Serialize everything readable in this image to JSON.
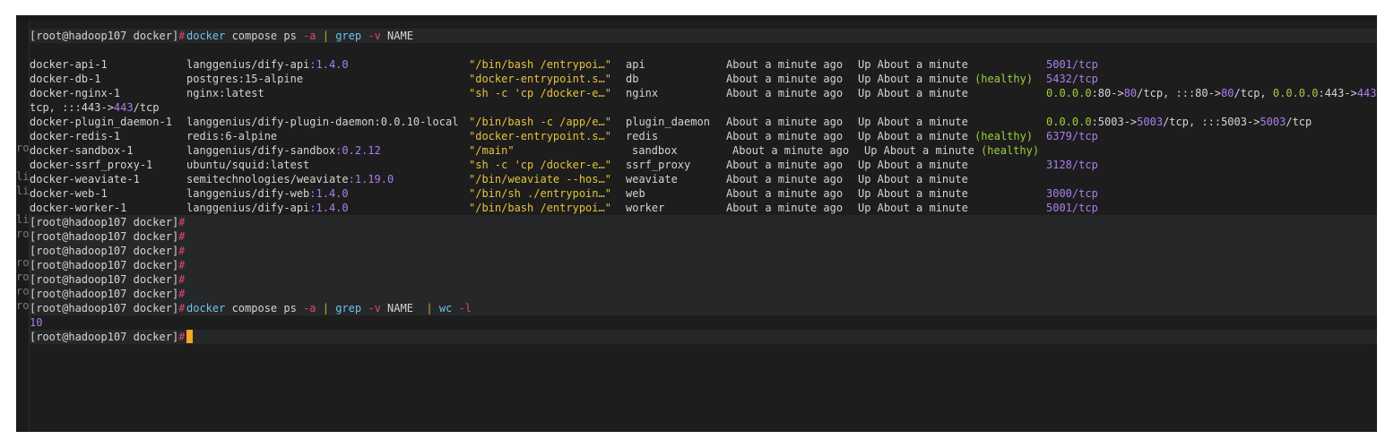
{
  "gutter": [
    "li",
    "ro",
    "li",
    "ro",
    "li",
    "ro",
    "ro",
    "ro",
    "ro",
    "ro"
  ],
  "prompt": "[root@hadoop107 docker]",
  "hash": "#",
  "command1": {
    "cmd1": "docker",
    "rest1": " compose ps ",
    "flag1": "-a",
    "pipe": " | ",
    "cmd2": "grep",
    "sp": " ",
    "flag2": "-v",
    "rest2": " NAME"
  },
  "containers": [
    {
      "name": "docker-api-1",
      "image": "langgenius/dify-api",
      "tag": ":1.4.0",
      "command": "\"/bin/bash /entrypoi…\"",
      "service": "api",
      "created": "About a minute ago",
      "status": "Up About a minute",
      "health": "",
      "ports": "5001/tcp"
    },
    {
      "name": "docker-db-1",
      "image": "postgres:15-alpine",
      "tag": "",
      "command": "\"docker-entrypoint.s…\"",
      "service": "db",
      "created": "About a minute ago",
      "status": "Up About a minute",
      "health": "(healthy)",
      "ports": "5432/tcp"
    },
    {
      "name": "docker-nginx-1",
      "image": "nginx:latest",
      "tag": "",
      "command": "\"sh -c 'cp /docker-e…\"",
      "service": "nginx",
      "created": "About a minute ago",
      "status": "Up About a minute",
      "health": "",
      "ports_parts": {
        "a": "0.0.0.0",
        "b": ":80->",
        "c": "80",
        "d": "/tcp, :::80->",
        "e": "80",
        "f": "/tcp, ",
        "g": "0.0.0.0",
        "h": ":443->",
        "i": "443/"
      },
      "ports_cont": {
        "a": "tcp, :::443->",
        "b": "443",
        "c": "/tcp"
      }
    },
    {
      "name": "docker-plugin_daemon-1",
      "image": "langgenius/dify-plugin-daemon:0.0.10-local",
      "tag": "",
      "command": "\"/bin/bash -c /app/e…\"",
      "service": "plugin_daemon",
      "created": "About a minute ago",
      "status": "Up About a minute",
      "health": "",
      "ports_parts": {
        "a": "0.0.0.0",
        "b": ":5003->",
        "c": "5003",
        "d": "/tcp, :::5003->",
        "e": "5003",
        "f": "/tcp"
      }
    },
    {
      "name": "docker-redis-1",
      "image": "redis:6-alpine",
      "tag": "",
      "command": "\"docker-entrypoint.s…\"",
      "service": "redis",
      "created": "About a minute ago",
      "status": "Up About a minute",
      "health": "(healthy)",
      "ports": "6379/tcp"
    },
    {
      "name": "docker-sandbox-1",
      "image": "langgenius/dify-sandbox",
      "tag": ":0.2.12",
      "command": "\"/main\"",
      "service": "sandbox",
      "created": "About a minute ago",
      "status": "Up About a minute",
      "health": "(healthy)",
      "ports": ""
    },
    {
      "name": "docker-ssrf_proxy-1",
      "image": "ubuntu/squid:latest",
      "tag": "",
      "command": "\"sh -c 'cp /docker-e…\"",
      "service": "ssrf_proxy",
      "created": "About a minute ago",
      "status": "Up About a minute",
      "health": "",
      "ports": "3128/tcp"
    },
    {
      "name": "docker-weaviate-1",
      "image": "semitechnologies/weaviate",
      "tag": ":1.19.0",
      "command": "\"/bin/weaviate --hos…\"",
      "service": "weaviate",
      "created": "About a minute ago",
      "status": "Up About a minute",
      "health": "",
      "ports": ""
    },
    {
      "name": "docker-web-1",
      "image": "langgenius/dify-web",
      "tag": ":1.4.0",
      "command": "\"/bin/sh ./entrypoin…\"",
      "service": "web",
      "created": "About a minute ago",
      "status": "Up About a minute",
      "health": "",
      "ports": "3000/tcp"
    },
    {
      "name": "docker-worker-1",
      "image": "langgenius/dify-api",
      "tag": ":1.4.0",
      "command": "\"/bin/bash /entrypoi…\"",
      "service": "worker",
      "created": "About a minute ago",
      "status": "Up About a minute",
      "health": "",
      "ports": "5001/tcp"
    }
  ],
  "command2": {
    "cmd1": "docker",
    "rest1": " compose ps ",
    "flag1": "-a",
    "pipe1": " | ",
    "cmd2": "grep",
    "sp": " ",
    "flag2": "-v",
    "rest2": " NAME  ",
    "pipe2": "| ",
    "cmd3": "wc",
    "sp2": " ",
    "flag3": "-l"
  },
  "output_count": "10",
  "colors": {
    "background": "#1d1d1d",
    "prompt_hash": "#e0447a",
    "command": "#6cc5e5",
    "string": "#e6c23e",
    "number": "#a97ff0",
    "health": "#9fcf3c",
    "cursor": "#f5a623"
  }
}
